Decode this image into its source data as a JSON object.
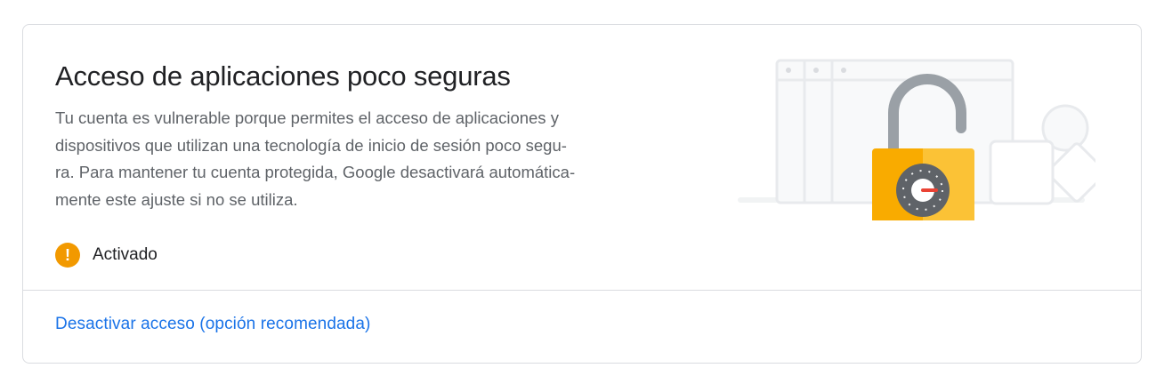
{
  "card": {
    "title": "Acceso de aplicaciones poco seguras",
    "description_lines": [
      "Tu cuenta es vulnerable porque permites el acceso de aplicaciones y",
      "dispositivos que utilizan una tecnología de inicio de sesión poco segu-",
      "ra. Para mantener tu cuenta protegida, Google desactivará automática-",
      "mente este ajuste si no se utiliza."
    ],
    "status": {
      "icon": "warning-icon",
      "icon_glyph": "!",
      "label": "Activado",
      "color": "#f29900"
    },
    "action_label": "Desactivar acceso (opción recomendada)",
    "illustration": "open-padlock-illustration"
  },
  "colors": {
    "link": "#1a73e8",
    "title": "#202124",
    "body": "#5f6368",
    "border": "#dadce0",
    "lock_body": "#f9ab00",
    "lock_dial": "#5f6368",
    "dial_needle": "#ea4335"
  }
}
